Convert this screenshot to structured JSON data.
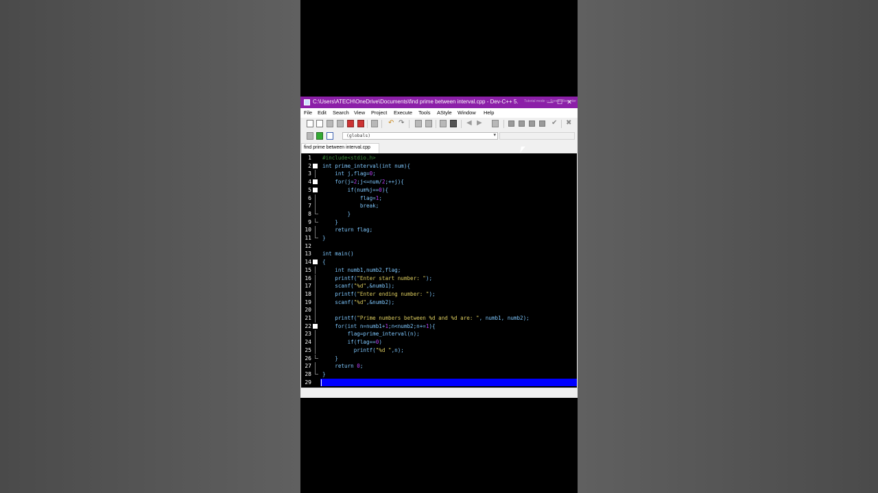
{
  "window": {
    "title": "C:\\Users\\ATECH\\OneDrive\\Documents\\find prime between interval.cpp - Dev-C++ 5...",
    "title_ghost": "Tutorial mode — Screen Recorder",
    "controls": {
      "minimize": "—",
      "maximize": "☐",
      "close": "✕"
    }
  },
  "menu": [
    "File",
    "Edit",
    "Search",
    "View",
    "Project",
    "Execute",
    "Tools",
    "AStyle",
    "Window",
    "Help"
  ],
  "toolbar": {
    "scope_combo": "(globals)",
    "combo_arrow": "▾",
    "undo_glyph": "↶",
    "redo_glyph": "↷",
    "check_glyph": "✔",
    "cancel_glyph": "✖",
    "prev_glyph": "◀",
    "next_glyph": "▶"
  },
  "tab": {
    "label": "find prime between interval.cpp"
  },
  "editor": {
    "lines": [
      {
        "n": "1",
        "html": "<span style=\"color:#3a8a3a\">#include&lt;stdio.h&gt;</span>"
      },
      {
        "n": "2",
        "html": "<span style=\"color:#7fc8ff\">int prime_interval(int num){</span>",
        "fold": "box"
      },
      {
        "n": "3",
        "html": "<span style=\"color:#7fc8ff\">    int j,flag=</span><span style=\"color:#c040ff\">0</span><span style=\"color:#7fc8ff\">;</span>",
        "fold": "line"
      },
      {
        "n": "4",
        "html": "<span style=\"color:#7fc8ff\">    for(j=</span><span style=\"color:#c040ff\">2</span><span style=\"color:#7fc8ff\">;j&lt;=num/</span><span style=\"color:#c040ff\">2</span><span style=\"color:#7fc8ff\">;++j){</span>",
        "fold": "box"
      },
      {
        "n": "5",
        "html": "<span style=\"color:#7fc8ff\">        if(num%j==</span><span style=\"color:#c040ff\">0</span><span style=\"color:#7fc8ff\">){</span>",
        "fold": "box"
      },
      {
        "n": "6",
        "html": "<span style=\"color:#7fc8ff\">            flag=</span><span style=\"color:#c040ff\">1</span><span style=\"color:#7fc8ff\">;</span>",
        "fold": "line"
      },
      {
        "n": "7",
        "html": "<span style=\"color:#7fc8ff\">            break;</span>",
        "fold": "line"
      },
      {
        "n": "8",
        "html": "<span style=\"color:#7fc8ff\">        }</span>",
        "fold": "end"
      },
      {
        "n": "9",
        "html": "<span style=\"color:#7fc8ff\">    }</span>",
        "fold": "end"
      },
      {
        "n": "10",
        "html": "<span style=\"color:#7fc8ff\">    return flag;</span>",
        "fold": "line"
      },
      {
        "n": "11",
        "html": "<span style=\"color:#7fc8ff\">}</span>",
        "fold": "end"
      },
      {
        "n": "12",
        "html": ""
      },
      {
        "n": "13",
        "html": "<span style=\"color:#7fc8ff\">int main()</span>"
      },
      {
        "n": "14",
        "html": "<span style=\"color:#7fc8ff\">{</span>",
        "fold": "box"
      },
      {
        "n": "15",
        "html": "<span style=\"color:#7fc8ff\">    int numb1,numb2,flag;</span>",
        "fold": "line"
      },
      {
        "n": "16",
        "html": "<span style=\"color:#7fc8ff\">    printf(</span><span style=\"color:#e0d060\">\"Enter start number: \"</span><span style=\"color:#7fc8ff\">);</span>",
        "fold": "line"
      },
      {
        "n": "17",
        "html": "<span style=\"color:#7fc8ff\">    scanf(</span><span style=\"color:#e0d060\">\"%d\"</span><span style=\"color:#7fc8ff\">,&amp;numb1);</span>",
        "fold": "line"
      },
      {
        "n": "18",
        "html": "<span style=\"color:#7fc8ff\">    printf(</span><span style=\"color:#e0d060\">\"Enter ending number: \"</span><span style=\"color:#7fc8ff\">);</span>",
        "fold": "line"
      },
      {
        "n": "19",
        "html": "<span style=\"color:#7fc8ff\">    scanf(</span><span style=\"color:#e0d060\">\"%d\"</span><span style=\"color:#7fc8ff\">,&amp;numb2);</span>",
        "fold": "line"
      },
      {
        "n": "20",
        "html": "",
        "fold": "line"
      },
      {
        "n": "21",
        "html": "<span style=\"color:#7fc8ff\">    printf(</span><span style=\"color:#e0d060\">\"Prime numbers between %d and %d are: \"</span><span style=\"color:#7fc8ff\">, numb1, numb2);</span>",
        "fold": "line"
      },
      {
        "n": "22",
        "html": "<span style=\"color:#7fc8ff\">    for(int n=numb1+</span><span style=\"color:#c040ff\">1</span><span style=\"color:#7fc8ff\">;n&lt;numb2;n+=</span><span style=\"color:#c040ff\">1</span><span style=\"color:#7fc8ff\">){</span>",
        "fold": "box"
      },
      {
        "n": "23",
        "html": "<span style=\"color:#7fc8ff\">        flag=prime_interval(n);</span>",
        "fold": "line"
      },
      {
        "n": "24",
        "html": "<span style=\"color:#7fc8ff\">        if(flag==</span><span style=\"color:#c040ff\">0</span><span style=\"color:#7fc8ff\">)</span>",
        "fold": "line"
      },
      {
        "n": "25",
        "html": "<span style=\"color:#7fc8ff\">          printf(</span><span style=\"color:#e0d060\">\"%d \"</span><span style=\"color:#7fc8ff\">,n);</span>",
        "fold": "line"
      },
      {
        "n": "26",
        "html": "<span style=\"color:#7fc8ff\">    }</span>",
        "fold": "end"
      },
      {
        "n": "27",
        "html": "<span style=\"color:#7fc8ff\">    return </span><span style=\"color:#c040ff\">0</span><span style=\"color:#7fc8ff\">;</span>",
        "fold": "line"
      },
      {
        "n": "28",
        "html": "<span style=\"color:#7fc8ff\">}</span>",
        "fold": "end"
      },
      {
        "n": "29",
        "html": "",
        "current": true
      }
    ]
  },
  "colors": {
    "titlebar": "#8c1fa8",
    "editor_bg": "#000000",
    "current_line": "#0000ff",
    "keyword": "#7fc8ff",
    "number": "#c040ff",
    "string": "#e0d060",
    "preprocessor": "#3a8a3a"
  }
}
